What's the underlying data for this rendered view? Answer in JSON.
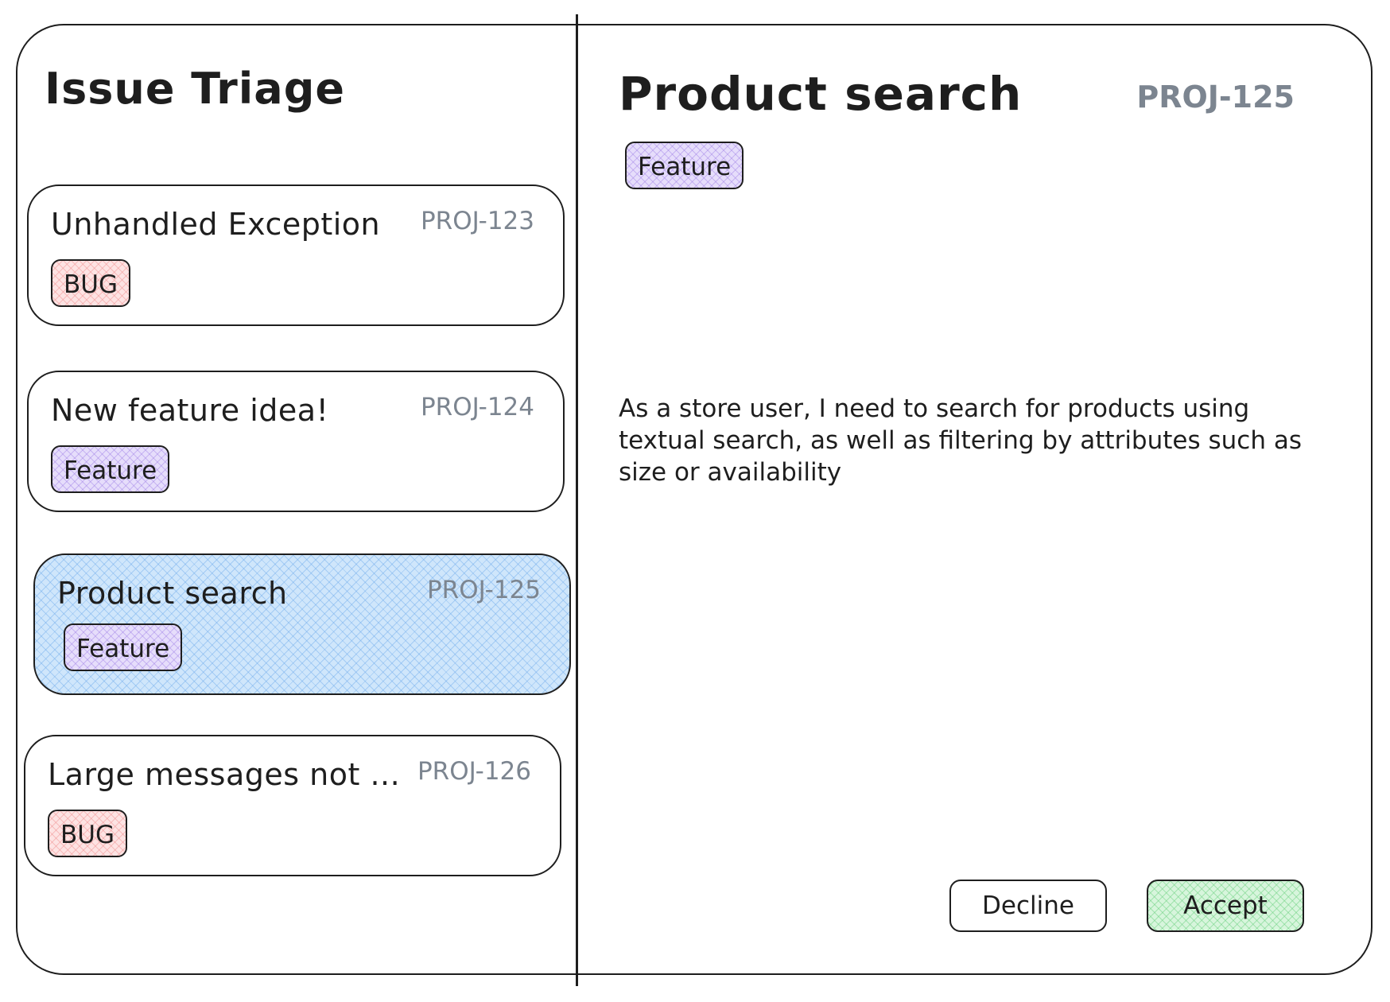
{
  "app": {
    "title": "Issue Triage"
  },
  "issues": [
    {
      "title": "Unhandled Exception",
      "id": "PROJ-123",
      "tag": "BUG",
      "selected": false
    },
    {
      "title": "New feature idea!",
      "id": "PROJ-124",
      "tag": "Feature",
      "selected": false
    },
    {
      "title": "Product search",
      "id": "PROJ-125",
      "tag": "Feature",
      "selected": true
    },
    {
      "title": "Large messages not ...",
      "id": "PROJ-126",
      "tag": "BUG",
      "selected": false
    }
  ],
  "detail": {
    "title": "Product search",
    "id": "PROJ-125",
    "tag": "Feature",
    "description": "As a store user, I need to search for products using textual search, as well as filtering by attributes such as size or availability"
  },
  "actions": {
    "decline_label": "Decline",
    "accept_label": "Accept"
  },
  "colors": {
    "selected_card": "#cfe6fb",
    "bug_tag": "#fde3e3",
    "feature_tag": "#e6ddfb",
    "accept_button": "#d7f5dc",
    "id_text": "#7c8590"
  }
}
